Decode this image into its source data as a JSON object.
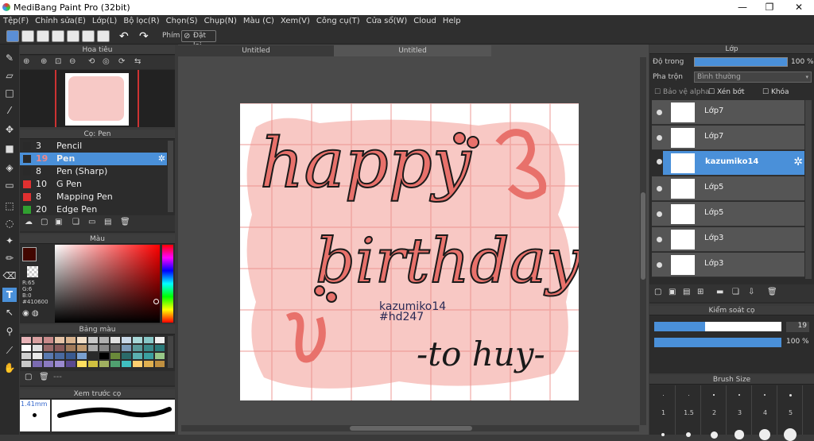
{
  "window": {
    "title": "MediBang Paint Pro (32bit)"
  },
  "menu": [
    "Tệp(F)",
    "Chỉnh sửa(E)",
    "Lớp(L)",
    "Bộ lọc(R)",
    "Chọn(S)",
    "Chụp(N)",
    "Màu (C)",
    "Xem(V)",
    "Công cụ(T)",
    "Cửa sổ(W)",
    "Cloud",
    "Help"
  ],
  "toolbar": {
    "phim": "Phím",
    "reset": "Đặt lại"
  },
  "navigator": {
    "title": "Hoa tiêu"
  },
  "brush": {
    "title": "Cọ: Pen",
    "items": [
      {
        "size": "3",
        "name": "Pencil",
        "color": "#2a2a2a"
      },
      {
        "size": "19",
        "name": "Pen",
        "color": "#2a2a2a",
        "selected": true
      },
      {
        "size": "8",
        "name": "Pen (Sharp)",
        "color": "#2a2a2a"
      },
      {
        "size": "10",
        "name": "G Pen",
        "color": "#e03030"
      },
      {
        "size": "8",
        "name": "Mapping Pen",
        "color": "#e03030"
      },
      {
        "size": "20",
        "name": "Edge Pen",
        "color": "#30a030"
      }
    ]
  },
  "color": {
    "title": "Màu",
    "r": "R:65",
    "g": "G:6",
    "b": "B:0",
    "hex": "#410600",
    "current": "#410600"
  },
  "palette": {
    "title": "Bảng màu",
    "more": "---"
  },
  "preview": {
    "title": "Xem trước cọ",
    "size": "1.41mm"
  },
  "tabs": [
    "Untitled",
    "Untitled"
  ],
  "layers": {
    "title": "Lớp",
    "opacity_label": "Độ trong",
    "opacity_value": "100 %",
    "blend_label": "Pha trộn",
    "blend_value": "Bình thường",
    "alpha_label": "Bảo vệ alpha",
    "clip_label": "Xén bớt",
    "lock_label": "Khóa",
    "items": [
      {
        "name": "Lớp7",
        "selected": false
      },
      {
        "name": "Lớp7",
        "selected": false
      },
      {
        "name": "kazumiko14",
        "selected": true
      },
      {
        "name": "Lớp5",
        "selected": false
      },
      {
        "name": "Lớp5",
        "selected": false
      },
      {
        "name": "Lớp3",
        "selected": false
      },
      {
        "name": "Lớp3",
        "selected": false
      }
    ]
  },
  "brush_control": {
    "title": "Kiểm soát cọ",
    "size_value": "19",
    "opacity_value": "100 %",
    "size_level": 0.4,
    "opacity_level": 1.0
  },
  "brush_size": {
    "title": "Brush Size",
    "labels": [
      "1",
      "1.5",
      "2",
      "3",
      "4",
      "5"
    ]
  },
  "artwork": {
    "line1": "happy",
    "line2": "birthday",
    "sig1": "kazumiko14",
    "sig2": "#hd247",
    "to": "-to huy-"
  }
}
